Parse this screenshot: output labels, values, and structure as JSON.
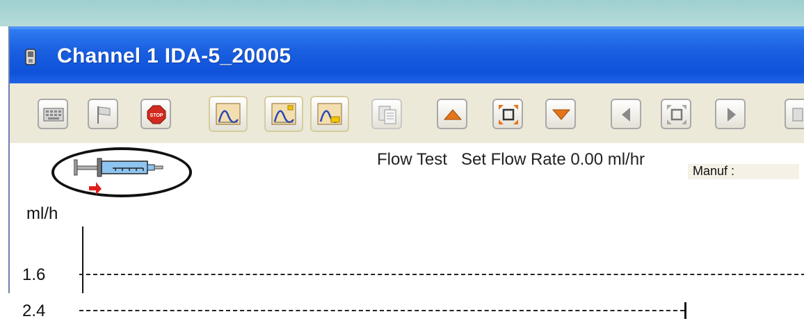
{
  "window": {
    "title": "Channel 1 IDA-5_20005"
  },
  "toolbar": {
    "buttons": [
      {
        "name": "keyboard-icon"
      },
      {
        "name": "flag-icon"
      },
      {
        "name": "stop-icon",
        "label": "STOP"
      },
      {
        "name": "chart-view-1-icon"
      },
      {
        "name": "chart-view-2-icon"
      },
      {
        "name": "chart-view-3-icon"
      },
      {
        "name": "report-icon"
      },
      {
        "name": "arrow-up-icon"
      },
      {
        "name": "fit-icon"
      },
      {
        "name": "arrow-down-icon"
      },
      {
        "name": "arrow-left-icon"
      },
      {
        "name": "fit-horizontal-icon"
      },
      {
        "name": "arrow-right-icon"
      }
    ]
  },
  "status": {
    "test_name": "Flow Test",
    "set_flow_label": "Set Flow Rate 0.00 ml/hr"
  },
  "chart": {
    "unit": "ml/h",
    "ticks": [
      "1.6",
      "2.4"
    ]
  },
  "info": {
    "manuf_label": "Manuf :"
  },
  "colors": {
    "title_bar": "#1a5fe0",
    "toolbar_bg": "#ece9d8",
    "stop_red": "#d22a1e",
    "arrow_orange": "#e5741a",
    "syringe_blue": "#8ec4f0"
  }
}
